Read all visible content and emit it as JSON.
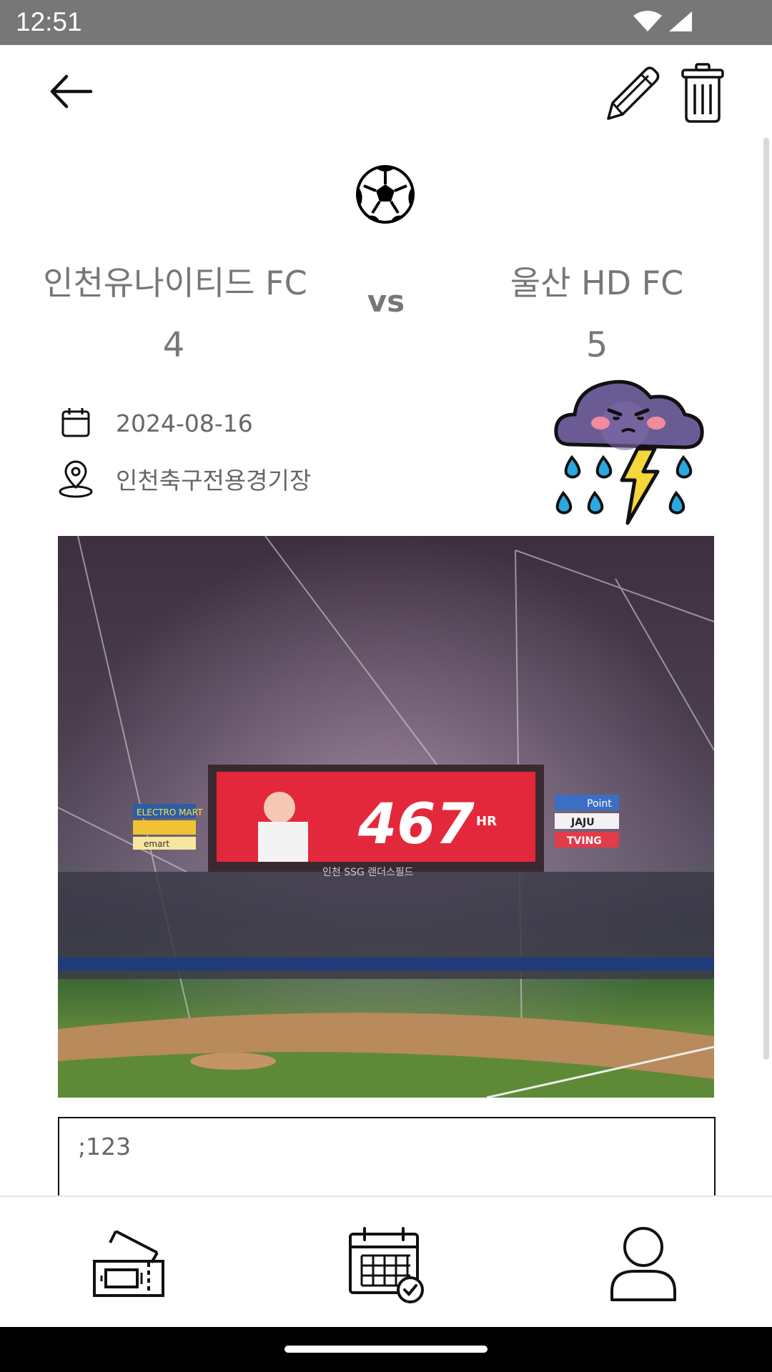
{
  "status_bar": {
    "time": "12:51",
    "icons": [
      "wifi-icon",
      "signal-icon"
    ]
  },
  "app_bar": {
    "back_icon": "back-arrow-icon",
    "edit_icon": "pencil-icon",
    "delete_icon": "trash-icon"
  },
  "match": {
    "sport_icon": "soccer-ball-icon",
    "home_team": "인천유나이티드 FC",
    "away_team": "울산 HD FC",
    "vs_label": "vs",
    "home_score": "4",
    "away_score": "5",
    "date": "2024-08-16",
    "stadium": "인천축구전용경기장",
    "weather_icon": "storm-cloud-icon"
  },
  "photo": {
    "scoreboard_text": "467",
    "scoreboard_sub": "HR",
    "board_left": [
      "ELECTRO MART",
      "",
      "emart"
    ],
    "board_right": [
      "Point",
      "JAJU",
      "TVING"
    ],
    "stadium_sign": "인천 SSG 랜더스필드"
  },
  "memo": {
    "text": ";123"
  },
  "bottom_nav": {
    "items": [
      {
        "icon": "ticket-icon"
      },
      {
        "icon": "calendar-check-icon"
      },
      {
        "icon": "profile-icon"
      }
    ]
  }
}
